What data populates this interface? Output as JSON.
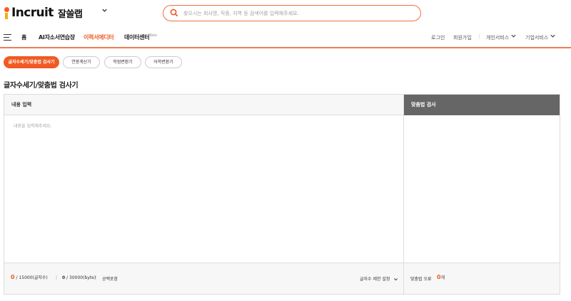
{
  "brand": {
    "logo_text": "Incruit",
    "service_name": "잘쓸랩",
    "accent": "#f05a23"
  },
  "search": {
    "placeholder": "찾으시는 회사명, 직종, 지역 등 검색어를 입력해주세요."
  },
  "nav": {
    "items": [
      "홈",
      "AI자소서연습장",
      "이력서에디터",
      "데이터센터"
    ],
    "beta_badge": "Beta",
    "utility": [
      "로그인",
      "회원가입",
      "개인서비스",
      "기업서비스"
    ]
  },
  "tabs": [
    "글자수세기/맞춤법 검사기",
    "연봉계산기",
    "학점변환기",
    "어학변환기"
  ],
  "page_title": "글자수세기/맞춤법 검사기",
  "editor": {
    "header": "내용 입력",
    "placeholder": "내용을 입력해주세요.",
    "char_count": "0",
    "char_total": "/ 15000(글자수)",
    "byte_count": "0",
    "byte_total": "/ 30000(byte)",
    "space_label": "공백포함",
    "limit_setting": "글자수 제한 설정"
  },
  "spell": {
    "header": "맞춤법 검사",
    "error_label": "맞춤법 오류",
    "error_count": "0",
    "error_unit": "개"
  }
}
